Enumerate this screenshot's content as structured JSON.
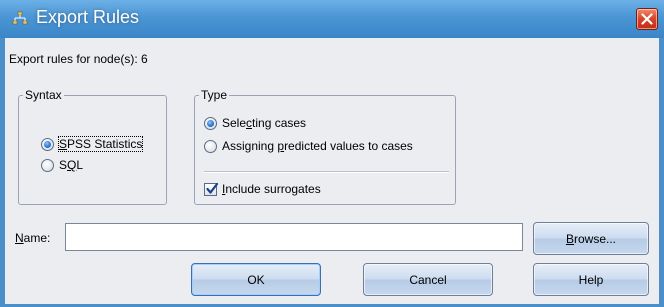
{
  "window": {
    "title": "Export Rules",
    "title_icon": "decision-tree-icon",
    "close_icon": "close-icon",
    "colors": {
      "titlebar": "#4b95d4",
      "client": "#ecedf1",
      "close": "#d4442a"
    }
  },
  "info": {
    "nodes_label": "Export rules for node(s): 6"
  },
  "syntax": {
    "title": "Syntax",
    "options": [
      {
        "pre": "",
        "key": "S",
        "post": "PSS Statistics",
        "selected": true
      },
      {
        "pre": "S",
        "key": "Q",
        "post": "L",
        "selected": false
      }
    ]
  },
  "type": {
    "title": "Type",
    "options": [
      {
        "pre": "Sele",
        "key": "c",
        "post": "ting cases",
        "selected": true
      },
      {
        "pre": "Assigning ",
        "key": "p",
        "post": "redicted values to cases",
        "selected": false
      }
    ],
    "surrogates": {
      "pre": "",
      "key": "I",
      "post": "nclude surrogates",
      "checked": true
    }
  },
  "name": {
    "label_key": "N",
    "label_post": "ame:",
    "value": "",
    "placeholder": ""
  },
  "buttons": {
    "browse": {
      "pre": "",
      "key": "B",
      "post": "rowse..."
    },
    "ok": "OK",
    "cancel": "Cancel",
    "help": "Help"
  }
}
